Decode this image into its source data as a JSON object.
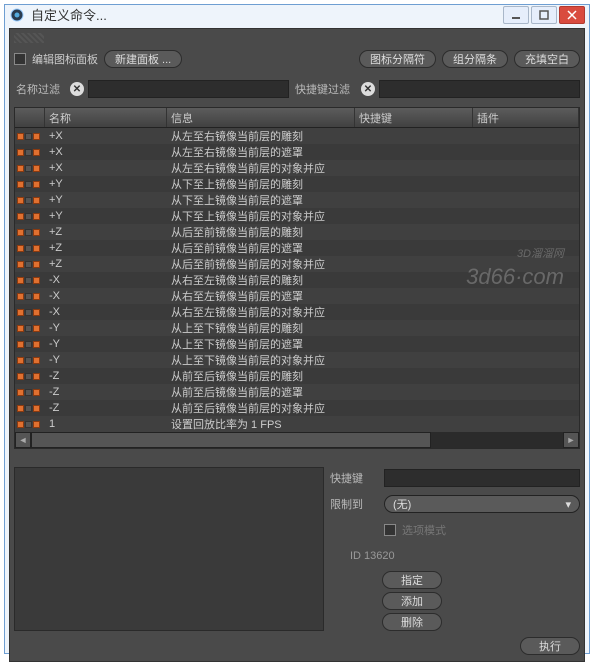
{
  "window": {
    "title": "自定义命令..."
  },
  "toolbar": {
    "edit_palette": "编辑图标面板",
    "new_palette": "新建面板 ...",
    "icon_sep": "图标分隔符",
    "group_sep": "组分隔条",
    "fill_blank": "充填空白"
  },
  "filters": {
    "name_label": "名称过滤",
    "shortcut_label": "快捷键过滤"
  },
  "columns": {
    "name": "名称",
    "info": "信息",
    "shortcut": "快捷键",
    "plugin": "插件"
  },
  "rows": [
    {
      "name": "+X",
      "info": "从左至右镜像当前层的雕刻"
    },
    {
      "name": "+X",
      "info": "从左至右镜像当前层的遮罩"
    },
    {
      "name": "+X",
      "info": "从左至右镜像当前层的对象并应"
    },
    {
      "name": "+Y",
      "info": "从下至上镜像当前层的雕刻"
    },
    {
      "name": "+Y",
      "info": "从下至上镜像当前层的遮罩"
    },
    {
      "name": "+Y",
      "info": "从下至上镜像当前层的对象并应"
    },
    {
      "name": "+Z",
      "info": "从后至前镜像当前层的雕刻"
    },
    {
      "name": "+Z",
      "info": "从后至前镜像当前层的遮罩"
    },
    {
      "name": "+Z",
      "info": "从后至前镜像当前层的对象并应"
    },
    {
      "name": "-X",
      "info": "从右至左镜像当前层的雕刻"
    },
    {
      "name": "-X",
      "info": "从右至左镜像当前层的遮罩"
    },
    {
      "name": "-X",
      "info": "从右至左镜像当前层的对象并应"
    },
    {
      "name": "-Y",
      "info": "从上至下镜像当前层的雕刻"
    },
    {
      "name": "-Y",
      "info": "从上至下镜像当前层的遮罩"
    },
    {
      "name": "-Y",
      "info": "从上至下镜像当前层的对象并应"
    },
    {
      "name": "-Z",
      "info": "从前至后镜像当前层的雕刻"
    },
    {
      "name": "-Z",
      "info": "从前至后镜像当前层的遮罩"
    },
    {
      "name": "-Z",
      "info": "从前至后镜像当前层的对象并应"
    },
    {
      "name": "1",
      "info": "设置回放比率为 1 FPS"
    }
  ],
  "detail": {
    "shortcut_label": "快捷键",
    "restrict_label": "限制到",
    "restrict_value": "(无)",
    "option_mode": "选项模式",
    "id_text": "ID 13620",
    "assign": "指定",
    "add": "添加",
    "delete": "删除"
  },
  "footer": {
    "execute": "执行"
  },
  "watermark": {
    "l1": "3D溜溜网",
    "l2": "3d66·com"
  }
}
